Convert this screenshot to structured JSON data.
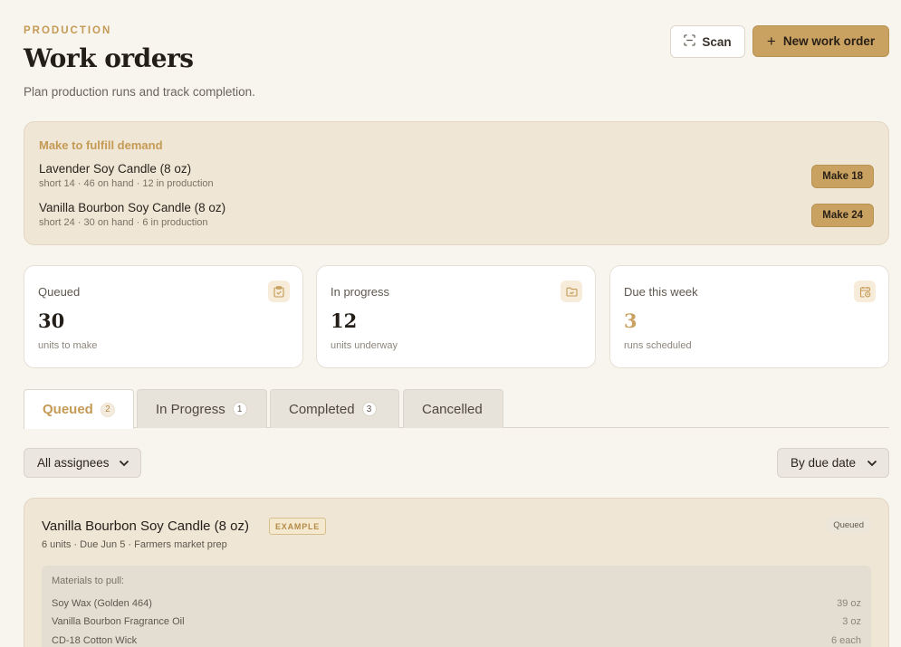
{
  "header": {
    "eyebrow": "PRODUCTION",
    "title": "Work orders",
    "subtitle": "Plan production runs and track completion.",
    "scan_label": "Scan",
    "new_label": "New work order"
  },
  "demand": {
    "title": "Make to fulfill demand",
    "items": [
      {
        "name": "Lavender Soy Candle (8 oz)",
        "meta": "short 14 · 46 on hand · 12 in production",
        "action": "Make 18"
      },
      {
        "name": "Vanilla Bourbon Soy Candle (8 oz)",
        "meta": "short 24 · 30 on hand · 6 in production",
        "action": "Make 24"
      }
    ]
  },
  "stats": [
    {
      "label": "Queued",
      "value": "30",
      "sub": "units to make",
      "icon": "clipboard-check-icon"
    },
    {
      "label": "In progress",
      "value": "12",
      "sub": "units underway",
      "icon": "folder-icon"
    },
    {
      "label": "Due this week",
      "value": "3",
      "sub": "runs scheduled",
      "icon": "calendar-clock-icon"
    }
  ],
  "tabs": [
    {
      "label": "Queued",
      "count": "2"
    },
    {
      "label": "In Progress",
      "count": "1"
    },
    {
      "label": "Completed",
      "count": "3"
    },
    {
      "label": "Cancelled",
      "count": ""
    }
  ],
  "filters": {
    "assignee": "All assignees",
    "sort": "By due date"
  },
  "order": {
    "title": "Vanilla Bourbon Soy Candle (8 oz)",
    "tag": "EXAMPLE",
    "status": "Queued",
    "meta": "6 units · Due Jun 5 · Farmers market prep",
    "materials_title": "Materials to pull:",
    "materials": [
      {
        "name": "Soy Wax (Golden 464)",
        "qty": "39 oz"
      },
      {
        "name": "Vanilla Bourbon Fragrance Oil",
        "qty": "3 oz"
      },
      {
        "name": "CD-18 Cotton Wick",
        "qty": "6 each"
      }
    ]
  },
  "colors": {
    "accent": "#c9a262",
    "accent_text": "#c49a55",
    "background": "#f8f5ef",
    "card_tint": "#efe6d6"
  }
}
